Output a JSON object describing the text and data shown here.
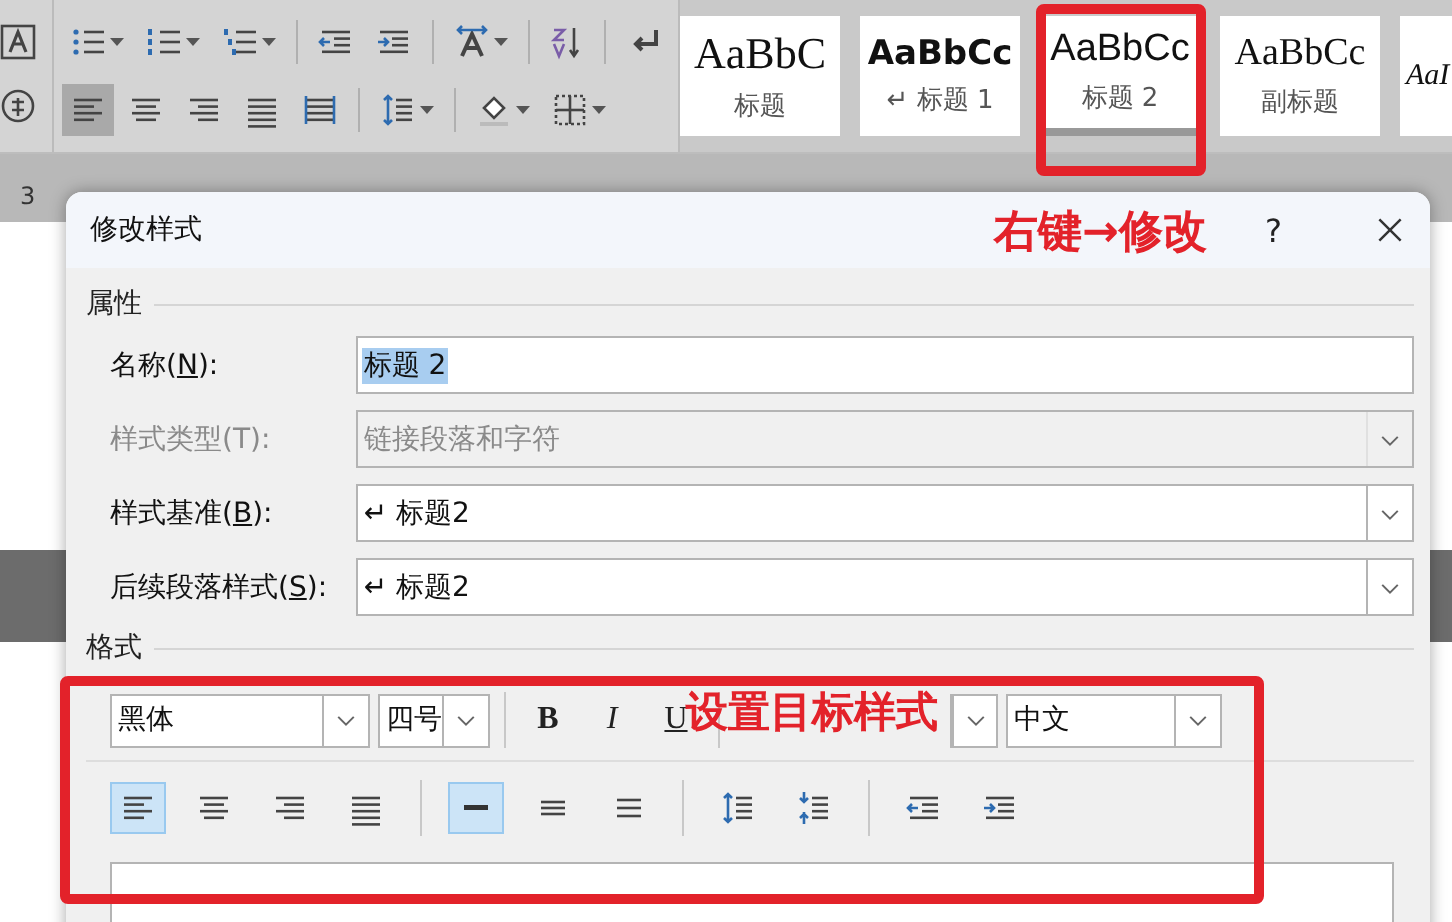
{
  "ribbon": {
    "tool_rows": [
      [
        {
          "kind": "bullets",
          "dropdown": true,
          "selected": false
        },
        {
          "kind": "numbering",
          "dropdown": true,
          "selected": false
        },
        {
          "kind": "multilevel",
          "dropdown": true,
          "selected": false
        },
        {
          "kind": "sep"
        },
        {
          "kind": "outdent",
          "dropdown": false,
          "selected": false
        },
        {
          "kind": "indent",
          "dropdown": false,
          "selected": false
        },
        {
          "kind": "sep"
        },
        {
          "kind": "direction",
          "dropdown": true,
          "selected": false
        },
        {
          "kind": "sep"
        },
        {
          "kind": "sort",
          "dropdown": false,
          "selected": false
        },
        {
          "kind": "sep"
        },
        {
          "kind": "mark",
          "dropdown": false,
          "selected": false
        }
      ],
      [
        {
          "kind": "left",
          "dropdown": false,
          "selected": true
        },
        {
          "kind": "center",
          "dropdown": false,
          "selected": false
        },
        {
          "kind": "right",
          "dropdown": false,
          "selected": false
        },
        {
          "kind": "justify",
          "dropdown": false,
          "selected": false
        },
        {
          "kind": "distribute",
          "dropdown": false,
          "selected": false
        },
        {
          "kind": "sep"
        },
        {
          "kind": "spacing",
          "dropdown": true,
          "selected": false
        },
        {
          "kind": "sep"
        },
        {
          "kind": "shading",
          "dropdown": true,
          "selected": false
        },
        {
          "kind": "borders",
          "dropdown": true,
          "selected": false
        }
      ]
    ],
    "styles": [
      {
        "sample": "AaBbC",
        "label": "标题",
        "kind": "title",
        "selected": false
      },
      {
        "sample": "AaBbCc",
        "label": "↵ 标题 1",
        "kind": "heading1",
        "selected": false
      },
      {
        "sample": "AaBbCc",
        "label": "标题 2",
        "kind": "heading2",
        "selected": true
      },
      {
        "sample": "AaBbCc",
        "label": "副标题",
        "kind": "subtitle",
        "selected": false
      },
      {
        "sample": "AaI",
        "kind": "emphasis",
        "selected": false
      }
    ]
  },
  "ruler": {
    "marker": "3"
  },
  "dialog": {
    "title": "修改样式",
    "help": "?",
    "properties_header": "属性",
    "fields": [
      {
        "before": "名称(",
        "key": "N",
        "after": "):",
        "value": "标题 2",
        "kind": "input",
        "disabled": false
      },
      {
        "before": "样式类型(T):",
        "value": "链接段落和字符",
        "kind": "select",
        "disabled": true
      },
      {
        "before": "样式基准(",
        "key": "B",
        "after": "):",
        "value": "↵ 标题2",
        "kind": "select",
        "disabled": false
      },
      {
        "before": "后续段落样式(",
        "key": "S",
        "after": "):",
        "value": "↵ 标题2",
        "kind": "select",
        "disabled": false
      }
    ],
    "format_header": "格式",
    "font": "黑体",
    "size": "四号",
    "style_buttons": [
      {
        "label": "B",
        "kind": "bold"
      },
      {
        "label": "I",
        "kind": "italic"
      },
      {
        "label": "U",
        "kind": "underline"
      }
    ],
    "language": "中文",
    "format_tools": [
      {
        "kind": "left",
        "selected": true
      },
      {
        "kind": "center",
        "selected": false
      },
      {
        "kind": "right",
        "selected": false
      },
      {
        "kind": "justify",
        "selected": false
      },
      {
        "kind": "sep"
      },
      {
        "kind": "single",
        "selected": true
      },
      {
        "kind": "onehalf",
        "selected": false
      },
      {
        "kind": "double",
        "selected": false
      },
      {
        "kind": "sep"
      },
      {
        "kind": "space-more",
        "selected": false
      },
      {
        "kind": "space-less",
        "selected": false
      },
      {
        "kind": "sep"
      },
      {
        "kind": "outdent",
        "selected": false
      },
      {
        "kind": "indent",
        "selected": false
      }
    ]
  },
  "annotations": [
    {
      "text": "右键→修改",
      "kind": "title"
    },
    {
      "text": "设置目标样式",
      "kind": "format"
    }
  ]
}
